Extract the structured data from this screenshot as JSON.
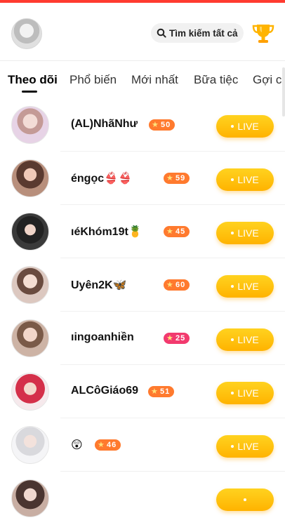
{
  "header": {
    "search_label": "Tìm kiếm tất cả"
  },
  "tabs": [
    {
      "label": "Theo dõi",
      "active": true
    },
    {
      "label": "Phổ biến",
      "active": false
    },
    {
      "label": "Mới nhất",
      "active": false
    },
    {
      "label": "Bữa tiệc",
      "active": false
    },
    {
      "label": "Gợi cả",
      "active": false
    }
  ],
  "colors": {
    "live_gradient_top": "#ffd21f",
    "live_gradient_bottom": "#ffb300",
    "badge_orange": "#ff7a2e",
    "badge_pink": "#f23a6e",
    "top_accent": "#ff3b30"
  },
  "rows": [
    {
      "name": "(AL)NhãNhư",
      "level": "50",
      "badge_color": "#ff7a2e",
      "live_label": "LIVE"
    },
    {
      "name": "éngọc👙👙",
      "level": "59",
      "badge_color": "#ff7a2e",
      "live_label": "LIVE"
    },
    {
      "name": "ıéKhóm19t🍍",
      "level": "45",
      "badge_color": "#ff7a2e",
      "live_label": "LIVE"
    },
    {
      "name": "Uyên2K🦋",
      "level": "60",
      "badge_color": "#ff7a2e",
      "live_label": "LIVE"
    },
    {
      "name": "ıingoanhiền",
      "level": "25",
      "badge_color": "#f23a6e",
      "live_label": "LIVE"
    },
    {
      "name": "ALCôGiáo69",
      "level": "51",
      "badge_color": "#ff7a2e",
      "live_label": "LIVE"
    },
    {
      "name": "😲",
      "level": "46",
      "badge_color": "#ff7a2e",
      "live_label": "LIVE"
    }
  ]
}
